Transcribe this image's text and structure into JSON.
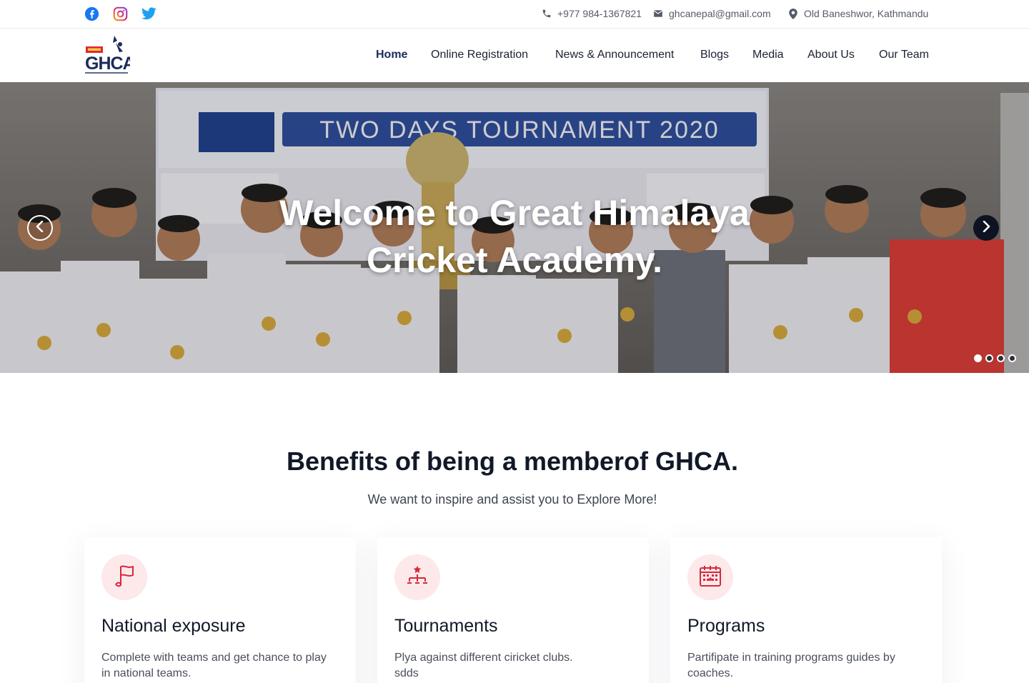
{
  "topbar": {
    "social": [
      {
        "name": "facebook",
        "icon": "facebook-icon",
        "color": "#1877f2"
      },
      {
        "name": "instagram",
        "icon": "instagram-icon",
        "color": "#e1306c"
      },
      {
        "name": "twitter",
        "icon": "twitter-icon",
        "color": "#1da1f2"
      }
    ],
    "phone": "+977 984-1367821",
    "email": "ghcanepal@gmail.com",
    "address": "Old Baneshwor, Kathmandu"
  },
  "header": {
    "logo_text": "GHCA",
    "nav": [
      {
        "label": "Home",
        "active": true
      },
      {
        "label": "Online Registration",
        "active": false
      },
      {
        "label": "News & Announcement",
        "active": false
      },
      {
        "label": "Blogs",
        "active": false
      },
      {
        "label": "Media",
        "active": false
      },
      {
        "label": "About Us",
        "active": false
      },
      {
        "label": "Our Team",
        "active": false
      }
    ]
  },
  "hero": {
    "title_line1": "Welcome to  Great Himalaya",
    "title_line2": "Cricket Academy.",
    "banner_text": "TWO DAYS TOURNAMENT 2020",
    "slides_total": 4,
    "active_slide": 1
  },
  "benefits": {
    "title": "Benefits of being a memberof GHCA.",
    "subtitle": "We want to inspire and assist you to Explore More!",
    "cards": [
      {
        "icon": "flag-icon",
        "title": "National exposure",
        "desc_line1": "Complete with teams and get chance to play",
        "desc_line2": "in national teams."
      },
      {
        "icon": "tournament-bracket-icon",
        "title": "Tournaments",
        "desc_line1": "Plya against different ciricket clubs.",
        "desc_line2": "sdds"
      },
      {
        "icon": "calendar-icon",
        "title": "Programs",
        "desc_line1": "Partifipate in training programs guides by",
        "desc_line2": "coaches."
      }
    ]
  },
  "colors": {
    "accent_red": "#d6283b",
    "navy": "#1b2c5a",
    "badge_bg": "#fde8ea"
  }
}
